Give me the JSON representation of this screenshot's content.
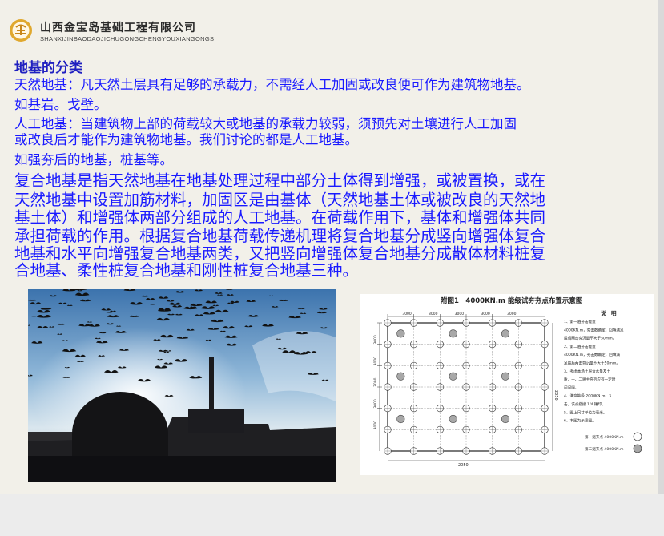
{
  "header": {
    "company_cn": "山西金宝岛基础工程有限公司",
    "company_en": "SHANXIJINBAODAOJICHUGONGCHENGYOUXIANGONGSI",
    "logo_color": "#e0a82e"
  },
  "content": {
    "heading": "地基的分类",
    "natural_line1": "天然地基：凡天然土层具有足够的承载力，不需经人工加固或改良便可作为建筑物地基。",
    "natural_line2": " 如基岩。戈壁。",
    "artificial_line1": "人工地基：当建筑物上部的荷载较大或地基的承载力较弱，须预先对土壤进行人工加固",
    "artificial_line2": "或改良后才能作为建筑物地基。我们讨论的都是人工地基。",
    "artificial_line3": "如强夯后的地基，桩基等。",
    "composite_lines": [
      "复合地基是指天然地基在地基处理过程中部分土体得到增强，或被置换，或在",
      "天然地基中设置加筋材料，加固区是由基体（天然地基土体或被改良的天然地",
      "基土体）和增强体两部分组成的人工地基。在荷载作用下，基体和增强体共同",
      "承担荷载的作用。根据复合地基荷载传递机理将复合地基分成竖向增强体复合",
      "地基和水平向增强复合地基两类，又把竖向增强体复合地基分成散体材料桩复",
      "合地基、柔性桩复合地基和刚性桩复合地基三种。"
    ],
    "text_color": "#1a1aff"
  },
  "diagram": {
    "title": "附图1　4000KN.m 能级试夯夯点布置示意图",
    "top_dims": [
      "3000",
      "3000",
      "3000",
      "3000",
      "3000"
    ],
    "left_dims": [
      "3000",
      "3000",
      "3000",
      "3000",
      "3000"
    ],
    "bottom_dim": "2050",
    "right_dim": "2050",
    "notes_title": "说　明",
    "notes": [
      "1、第一遍夯击能量",
      "4000KN.m，夯击数确定，回填满足",
      "最后两击夯沉量不大于50mm。",
      "2、第二遍夯击能量",
      "4000KN.m，夯击数确定，回填满",
      "足最后两击夯沉量不大于50mm。",
      "3、考虑本场土层含水量及土",
      "质，一、二遍主夯后应有一定时",
      "间间隔。",
      "4、满夯能级 2000KN.m，3",
      "击，该点搭接 1/4 锤印。",
      "5、图上尺寸单位为毫米。",
      "6、本图为示意图。"
    ],
    "legend": [
      {
        "label": "第一遍夯点 4000KN.m",
        "fill": "#ffffff"
      },
      {
        "label": "第二遍夯点 4000KN.m",
        "fill": "#a8a8a8"
      }
    ]
  }
}
